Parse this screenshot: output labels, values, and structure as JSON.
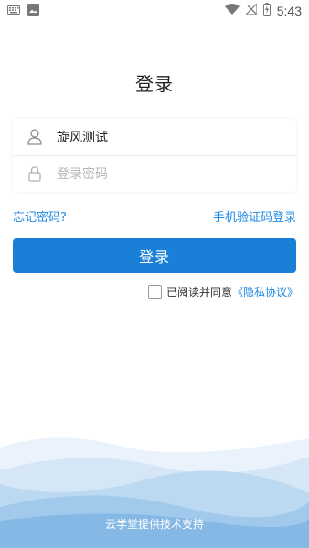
{
  "statusbar": {
    "time": "5:43",
    "left_icons": [
      "keyboard-icon",
      "image-icon"
    ],
    "right_icons": [
      "wifi-icon",
      "no-signal-icon",
      "battery-charging-icon"
    ]
  },
  "page": {
    "title": "登录"
  },
  "form": {
    "username_value": "旋风测试",
    "password_placeholder": "登录密码"
  },
  "links": {
    "forgot": "忘记密码?",
    "sms_login": "手机验证码登录"
  },
  "buttons": {
    "login_label": "登录"
  },
  "agreement": {
    "text": "已阅读并同意",
    "policy": "《隐私协议》"
  },
  "footer": {
    "text": "云学堂提供技术支持"
  },
  "colors": {
    "primary": "#1a7fd6",
    "link": "#1e88e5"
  }
}
